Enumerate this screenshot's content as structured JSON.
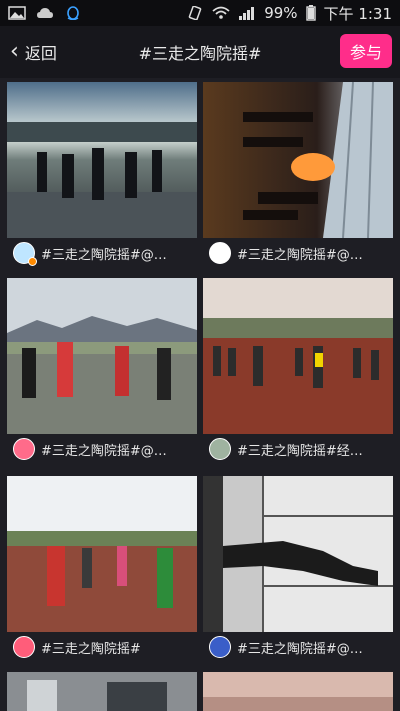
{
  "status_bar": {
    "icons": [
      "image-icon",
      "cloud-icon",
      "qq-icon",
      "vibrate-icon",
      "wifi-icon",
      "signal-icon"
    ],
    "battery": "99%",
    "time": "下午 1:31"
  },
  "header": {
    "back_label": "返回",
    "title": "#三走之陶院摇#",
    "join_label": "参与"
  },
  "videos": [
    {
      "caption": "#三走之陶院摇#@…"
    },
    {
      "caption": "#三走之陶院摇#@…"
    },
    {
      "caption": "#三走之陶院摇#@…"
    },
    {
      "caption": "#三走之陶院摇#经…"
    },
    {
      "caption": "#三走之陶院摇#"
    },
    {
      "caption": "#三走之陶院摇#@…"
    }
  ],
  "colors": {
    "accent": "#ff2d8a",
    "background": "#1e1e24"
  }
}
